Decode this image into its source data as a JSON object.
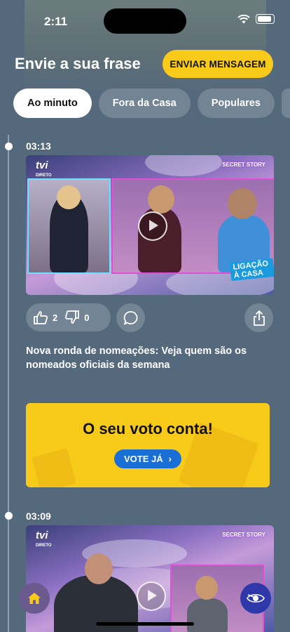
{
  "status": {
    "time": "2:11"
  },
  "header": {
    "title": "Envie a sua frase",
    "send_label": "ENVIAR MENSAGEM"
  },
  "tabs": [
    {
      "label": "Ao minuto"
    },
    {
      "label": "Fora da Casa"
    },
    {
      "label": "Populares"
    }
  ],
  "feed": [
    {
      "time": "03:13",
      "likes": "2",
      "dislikes": "0",
      "headline": "Nova ronda de nomeações: Veja quem são os nomeados oficiais da semana",
      "badge": "LIGAÇÃO À CASA"
    },
    {
      "time": "03:09"
    }
  ],
  "media_overlay": {
    "channel": "tvi",
    "channel_sub": "DIRETO",
    "show": "SECRET STORY"
  },
  "vote_card": {
    "title": "O seu voto conta!",
    "button": "VOTE JÁ",
    "button_chevron": "›"
  },
  "colors": {
    "accent": "#f8cb1b",
    "background": "#55697d",
    "vote_button": "#1a6fd6",
    "eye_button": "#2f38a8"
  },
  "icons": [
    "wifi-icon",
    "battery-icon",
    "thumbs-up-icon",
    "thumbs-down-icon",
    "comment-icon",
    "share-icon",
    "play-icon",
    "home-icon",
    "eye-icon"
  ]
}
